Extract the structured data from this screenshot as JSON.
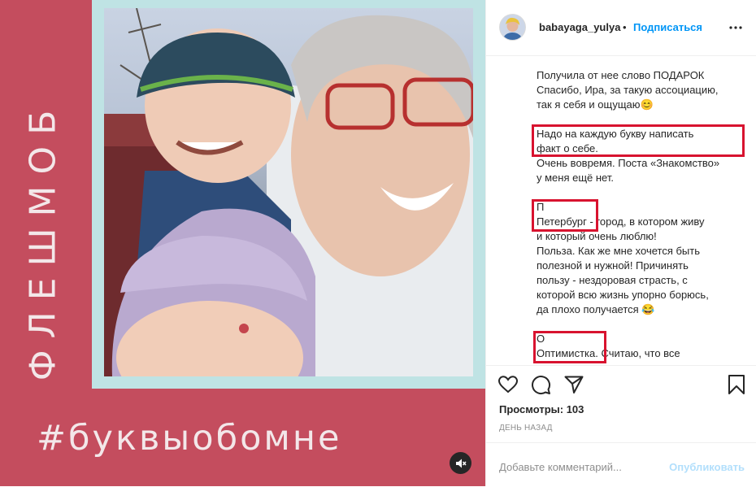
{
  "post": {
    "vertical_text": "ФЛЕШМОБ",
    "hashtag": "#буквыобомне"
  },
  "header": {
    "username": "babayaga_yulya",
    "separator": "•",
    "follow_label": "Подписаться"
  },
  "caption": {
    "lines": [
      "Получила от нее слово ПОДАРОК",
      "Спасибо, Ира, за такую ассоциацию,",
      "так я себя и ощущаю😊",
      "",
      "Надо на каждую букву написать",
      "факт о себе.",
      "Очень вовремя. Поста «Знакомство»",
      "у меня ещё нет.",
      "",
      "П",
      "Петербург - город, в котором живу",
      "и который очень люблю!",
      "Польза. Как же мне хочется быть",
      "полезной и нужной! Причинять",
      "пользу - нездоровая страсть, с",
      "которой всю жизнь упорно борюсь,",
      "да плохо получается 😂",
      "",
      "О",
      "Оптимистка. Считаю, что все"
    ]
  },
  "stats": {
    "views": "Просмотры: 103",
    "time": "ДЕНЬ НАЗАД"
  },
  "comment": {
    "placeholder": "Добавьте комментарий...",
    "publish_label": "Опубликовать"
  },
  "colors": {
    "background": "#c44d5e",
    "frame": "#bfe3e4",
    "highlight": "#d8132f",
    "accent": "#0095f6"
  }
}
